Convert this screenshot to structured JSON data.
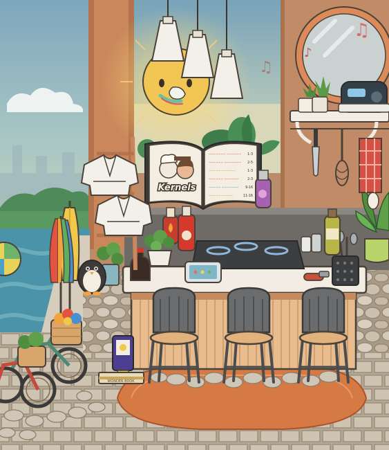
{
  "recipe_book": {
    "title": "Kernels",
    "menu_lines": [
      {
        "dish": "~~~~~~~ ~~~~~~",
        "price": "1-3"
      },
      {
        "dish": "~~~~~~ ~~~~~~~",
        "price": "2-5"
      },
      {
        "dish": "~~~~~~~~~~~",
        "price": "1-3"
      },
      {
        "dish": "~~~~~~ ~~~~~~",
        "price": "2-3"
      },
      {
        "dish": "~~~~~ ~~~~~~~",
        "price": "9-16"
      },
      {
        "dish": "~~~~~~~~~~",
        "price": "11-16"
      }
    ]
  },
  "book_bottom": {
    "label": "WONDER BOOK"
  },
  "colors": {
    "wall": "#b98c6b",
    "floor_stone": "#cbbfae",
    "rug": "#d9773f",
    "counter_top": "#f3ece2",
    "counter_front": "#e6b98a",
    "chair": "#5b5d5e",
    "sky": "#8fb8c9",
    "pool": "#3f8fa6"
  },
  "icons": {
    "sun": "sun-face-icon",
    "music": "music-note-icon",
    "tablet": "tablet-icon",
    "radio": "radio-icon"
  }
}
